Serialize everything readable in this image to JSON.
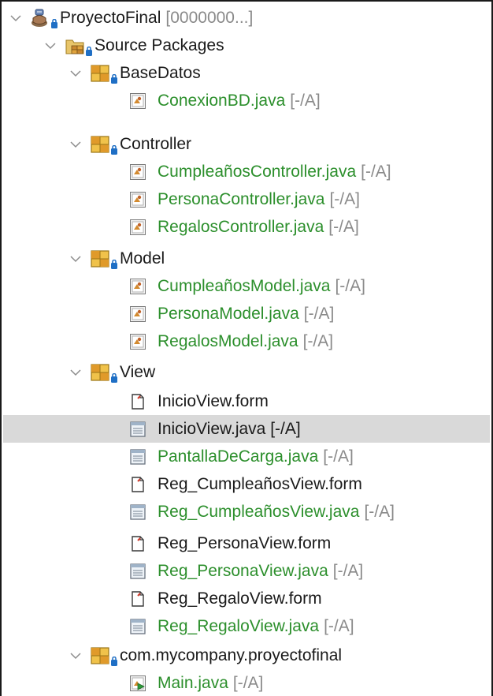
{
  "tree": {
    "project": {
      "label": "ProyectoFinal",
      "status": "[0000000...]"
    },
    "source_packages": {
      "label": "Source Packages"
    },
    "packages": [
      {
        "label": "BaseDatos",
        "files": [
          {
            "label": "ConexionBD.java",
            "status": "[-/A]",
            "kind": "java",
            "vcs": true
          }
        ]
      },
      {
        "label": "Controller",
        "files": [
          {
            "label": "CumpleañosController.java",
            "status": "[-/A]",
            "kind": "java",
            "vcs": true
          },
          {
            "label": "PersonaController.java",
            "status": "[-/A]",
            "kind": "java",
            "vcs": true
          },
          {
            "label": "RegalosController.java",
            "status": "[-/A]",
            "kind": "java",
            "vcs": true
          }
        ]
      },
      {
        "label": "Model",
        "files": [
          {
            "label": "CumpleañosModel.java",
            "status": "[-/A]",
            "kind": "java",
            "vcs": true
          },
          {
            "label": "PersonaModel.java",
            "status": "[-/A]",
            "kind": "java",
            "vcs": true
          },
          {
            "label": "RegalosModel.java",
            "status": "[-/A]",
            "kind": "java",
            "vcs": true
          }
        ]
      },
      {
        "label": "View",
        "files": [
          {
            "label": "InicioView.form",
            "status": "",
            "kind": "form",
            "vcs": false
          },
          {
            "label": "InicioView.java [-/A]",
            "status": "",
            "kind": "view",
            "vcs": false,
            "selected": true
          },
          {
            "label": "PantallaDeCarga.java",
            "status": "[-/A]",
            "kind": "view",
            "vcs": true
          },
          {
            "label": "Reg_CumpleañosView.form",
            "status": "",
            "kind": "form",
            "vcs": false
          },
          {
            "label": "Reg_CumpleañosView.java",
            "status": "[-/A]",
            "kind": "view",
            "vcs": true
          },
          {
            "label": "Reg_PersonaView.form",
            "status": "",
            "kind": "form",
            "vcs": false
          },
          {
            "label": "Reg_PersonaView.java",
            "status": "[-/A]",
            "kind": "view",
            "vcs": true
          },
          {
            "label": "Reg_RegaloView.form",
            "status": "",
            "kind": "form",
            "vcs": false
          },
          {
            "label": "Reg_RegaloView.java",
            "status": "[-/A]",
            "kind": "view",
            "vcs": true
          }
        ]
      },
      {
        "label": "com.mycompany.proyectofinal",
        "files": [
          {
            "label": "Main.java",
            "status": "[-/A]",
            "kind": "main",
            "vcs": true
          }
        ]
      }
    ]
  },
  "colors": {
    "vcs_added": "#2c8f2c",
    "status_gray": "#8a8a8a",
    "selection": "#d9d9d9",
    "text": "#1a1a1a"
  }
}
